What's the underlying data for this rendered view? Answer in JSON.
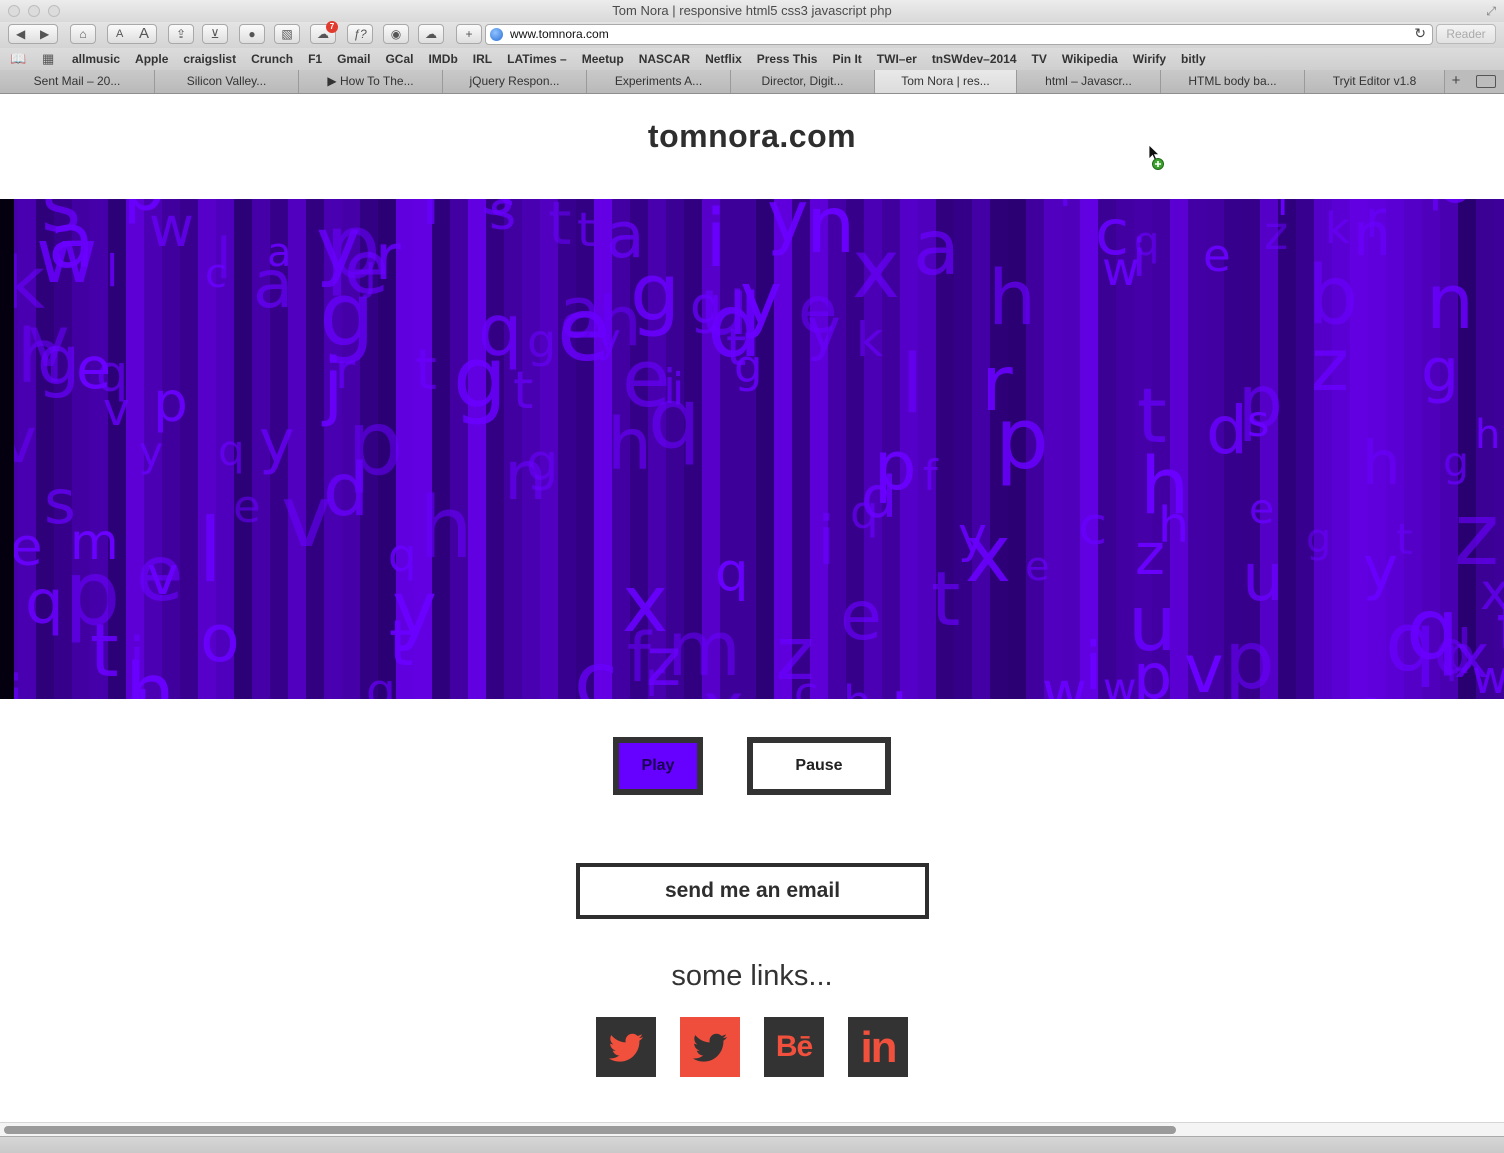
{
  "window": {
    "title": "Tom Nora | responsive html5 css3 javascript php"
  },
  "toolbar": {
    "url": "www.tomnora.com",
    "reader_label": "Reader",
    "small_font_label": "A",
    "large_font_label": "A",
    "add_label": "+",
    "badge_count": "7",
    "reload_icon": "reload-icon"
  },
  "bookmarks": [
    "allmusic",
    "Apple",
    "craigslist",
    "Crunch",
    "F1",
    "Gmail",
    "GCal",
    "IMDb",
    "IRL",
    "LATimes –",
    "Meetup",
    "NASCAR",
    "Netflix",
    "Press This",
    "Pin It",
    "TWI–er",
    "tnSWdev–2014",
    "TV",
    "Wikipedia",
    "Wirify",
    "bitly"
  ],
  "tabs": [
    {
      "label": "Sent Mail – 20..."
    },
    {
      "label": "Silicon Valley..."
    },
    {
      "label": "▶ How To The..."
    },
    {
      "label": "jQuery Respon..."
    },
    {
      "label": "Experiments A..."
    },
    {
      "label": "Director, Digit..."
    },
    {
      "label": "Tom Nora | res..."
    },
    {
      "label": "html – Javascr..."
    },
    {
      "label": "HTML body ba..."
    },
    {
      "label": "Tryit Editor v1.8"
    }
  ],
  "tab_add_label": "+",
  "page": {
    "site_title": "tomnora.com",
    "play_label": "Play",
    "pause_label": "Pause",
    "email_label": "send me an email",
    "links_heading": "some links...",
    "behance_label": "Bē",
    "linkedin_label": "in"
  },
  "colors": {
    "accent_purple": "#6600ff",
    "dark_box": "#333333",
    "social_red": "#f0503c",
    "social_red_bg": "#ef4e3c"
  }
}
